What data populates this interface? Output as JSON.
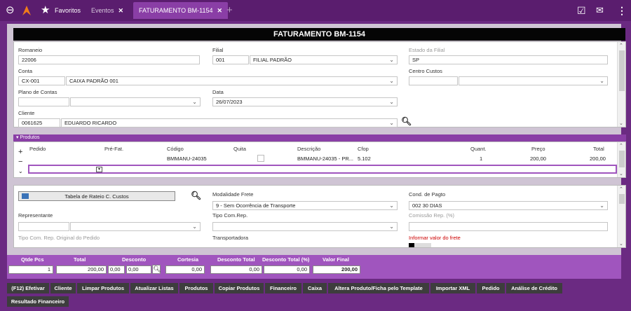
{
  "topbar": {
    "favoritos_label": "Favoritos",
    "tabs": [
      {
        "label": "Eventos"
      },
      {
        "label": "FATURAMENTO BM-1154"
      }
    ]
  },
  "title": "FATURAMENTO BM-1154",
  "header": {
    "romaneio_label": "Romaneio",
    "romaneio_value": "22006",
    "filial_label": "Filial",
    "filial_code": "001",
    "filial_name": "FILIAL PADRÃO",
    "estado_label": "Estado da Filial",
    "estado_value": "SP",
    "conta_label": "Conta",
    "conta_code": "CX-001",
    "conta_name": "CAIXA PADRÃO 001",
    "centro_label": "Centro Custos",
    "plano_label": "Plano de Contas",
    "data_label": "Data",
    "data_value": "26/07/2023",
    "cliente_label": "Cliente",
    "cliente_code": "0061625",
    "cliente_name": "EDUARDO RICARDO"
  },
  "produtos": {
    "section_label": "Produtos",
    "columns": [
      "Pedido",
      "Pré-Fat.",
      "Código",
      "Quita",
      "Descrição",
      "Cfop",
      "Quant.",
      "Preço",
      "Total"
    ],
    "rows": [
      {
        "codigo": "BMMANU-24035",
        "descricao": "BMMANU-24035 - PR...",
        "cfop": "5.102",
        "quant": "1",
        "preco": "200,00",
        "total": "200,00"
      }
    ]
  },
  "lower": {
    "rateio_label": "Tabela de Rateio C. Custos",
    "modalidade_label": "Modalidade Frete",
    "modalidade_value": "9 - Sem Ocorrência de Transporte",
    "cond_label": "Cond. de Pagto",
    "cond_code": "002",
    "cond_value": "30 DIAS",
    "representante_label": "Representante",
    "tipo_com_label": "Tipo Com.Rep.",
    "comissao_label": "Comissão Rep. (%)",
    "tipo_com_orig_label": "Tipo Com. Rep. Original do Pedido",
    "transportadora_label": "Transportadora",
    "frete_label": "Informar valor do frete"
  },
  "totals": {
    "qtde_label": "Qtde Pcs",
    "qtde_value": "1",
    "total_label": "Total",
    "total_value": "200,00",
    "desconto_label": "Desconto",
    "desconto_a": "0,00",
    "desconto_b": "0,00",
    "cortesia_label": "Cortesia",
    "cortesia_value": "0,00",
    "desc_total_label": "Desconto Total",
    "desc_total_value": "0,00",
    "desc_total_pct_label": "Desconto Total (%)",
    "desc_total_pct_value": "0,00",
    "valor_final_label": "Valor Final",
    "valor_final_value": "200,00"
  },
  "buttons": [
    "(F12) Efetivar",
    "Cliente",
    "Limpar Produtos",
    "Atualizar Listas",
    "Produtos",
    "Copiar Produtos",
    "Financeiro",
    "Caixa",
    "Altera Produto/Ficha pelo Template",
    "Importar XML",
    "Pedido",
    "Análise de Crédito",
    "Resultado Financeiro"
  ],
  "colors": {
    "accent": "#8a3ea6",
    "background": "#6b2a82",
    "title_bar": "#050505",
    "totals_bar": "#a055be",
    "button": "#3d3d3d"
  },
  "icons": [
    "back-arrow-icon",
    "logo-icon",
    "star-icon",
    "add-tab-icon",
    "clipboard-check-icon",
    "chat-icon",
    "more-vert-icon",
    "search-icon",
    "calculator-icon"
  ]
}
